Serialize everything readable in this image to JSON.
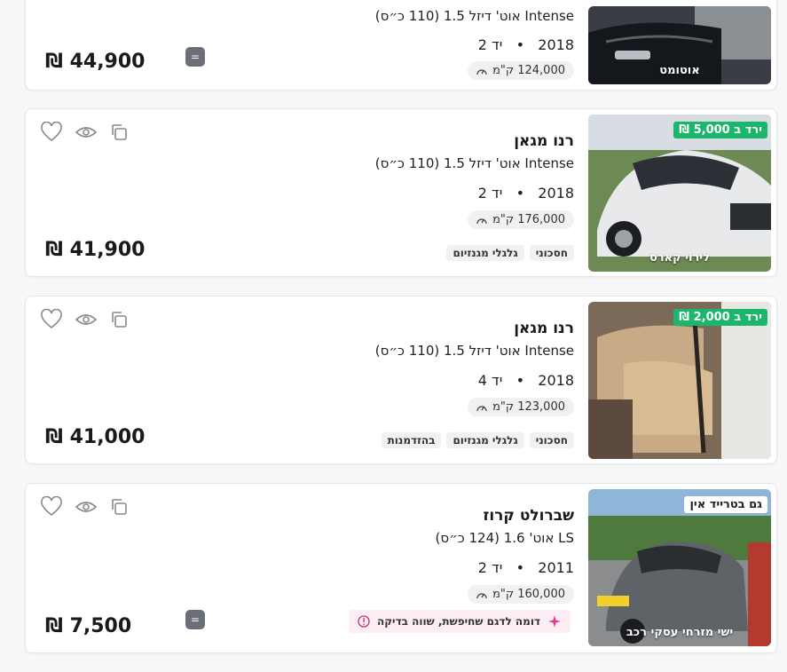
{
  "currency": "₪",
  "listings": [
    {
      "title": "",
      "subtitle": "Intense אוט' דיזל 1.5 (110 כ״ס)",
      "year": "2018",
      "hand": "יד 2",
      "km": "124,000 ק\"מ",
      "price": "44,900",
      "caption": "אוטומט",
      "promo": "",
      "tags": []
    },
    {
      "title": "רנו מגאן",
      "subtitle": "Intense אוט' דיזל 1.5 (110 כ״ס)",
      "year": "2018",
      "hand": "יד 2",
      "km": "176,000 ק\"מ",
      "price": "41,900",
      "caption": "לירוי קארס",
      "promo": "ירד ב 5,000 ₪",
      "tags": [
        "חסכוני",
        "גלגלי מגנזיום"
      ]
    },
    {
      "title": "רנו מגאן",
      "subtitle": "Intense אוט' דיזל 1.5 (110 כ״ס)",
      "year": "2018",
      "hand": "יד 4",
      "km": "123,000 ק\"מ",
      "price": "41,000",
      "caption": "",
      "promo": "ירד ב 2,000 ₪",
      "tags": [
        "חסכוני",
        "גלגלי מגנזיום",
        "בהזדמנות"
      ]
    },
    {
      "title": "שברולט קרוז",
      "subtitle": "LS אוט' 1.6 (124 כ״ס)",
      "year": "2011",
      "hand": "יד 2",
      "km": "160,000 ק\"מ",
      "price": "7,500",
      "caption": "ישי מזרחי עסקי רכב",
      "promo": "גם בטרייד אין",
      "tags": [],
      "hint": "דומה לדגם שחיפשת, שווה בדיקה"
    }
  ],
  "icons": {
    "favorite": "heart-icon",
    "views": "eye-icon",
    "compare": "copy-icon",
    "km": "speedometer-icon",
    "info": "info-icon",
    "sparkle": "sparkle-icon",
    "equal": "equal-icon"
  }
}
